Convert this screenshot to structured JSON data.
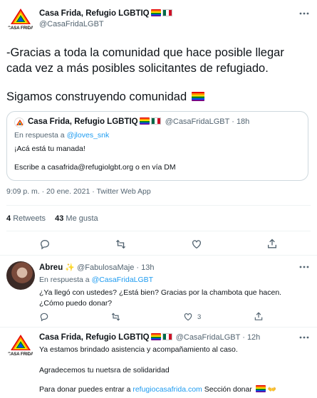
{
  "main_tweet": {
    "author_name": "Casa Frida, Refugio LGBTIQ",
    "author_handle": "@CasaFridaLGBT",
    "avatar_caption": "CASA FRIDA",
    "text_line1": "-Gracias a toda la comunidad que hace posible llegar",
    "text_line2": "cada vez a más posibles solicitantes de refugiado.",
    "text_line3": "Sigamos construyendo comunidad",
    "quoted": {
      "author_name": "Casa Frida, Refugio LGBTIQ",
      "author_handle": "@CasaFridaLGBT",
      "time": "· 18h",
      "reply_prefix": "En respuesta a",
      "reply_to": "@jloves_snk",
      "line1": "¡Acá está tu manada!",
      "line2": "Escribe a casafrida@refugiolgbt.org o en vía DM"
    },
    "timestamp": "9:09 p. m. · 20 ene. 2021 · Twitter Web App",
    "retweets_count": "4",
    "retweets_label": "Retweets",
    "likes_count": "43",
    "likes_label": "Me gusta"
  },
  "reply1": {
    "author_name": "Abreu",
    "author_handle": "@FabulosaMaje",
    "time": "· 13h",
    "reply_prefix": "En respuesta a",
    "reply_to": "@CasaFridaLGBT",
    "line1": "¿Ya llegó con ustedes? ¿Está bien? Gracias por la chambota que hacen.",
    "line2": "¿Cómo puedo donar?",
    "like_count": "3"
  },
  "reply2": {
    "author_name": "Casa Frida, Refugio LGBTIQ",
    "author_handle": "@CasaFridaLGBT",
    "time": "· 12h",
    "avatar_caption": "CASA FRIDA",
    "line1": "Ya estamos brindado asistencia y acompañamiento al caso.",
    "line2": "Agradecemos tu nuetsra de solidaridad",
    "line3_prefix": "Para donar puedes entrar a",
    "line3_link": "refugiocasafrida.com",
    "line3_suffix": "Sección donar"
  },
  "colors": {
    "accent": "#1d9bf0",
    "text": "#0f1419",
    "muted": "#536471",
    "divider": "#eff3f4"
  }
}
